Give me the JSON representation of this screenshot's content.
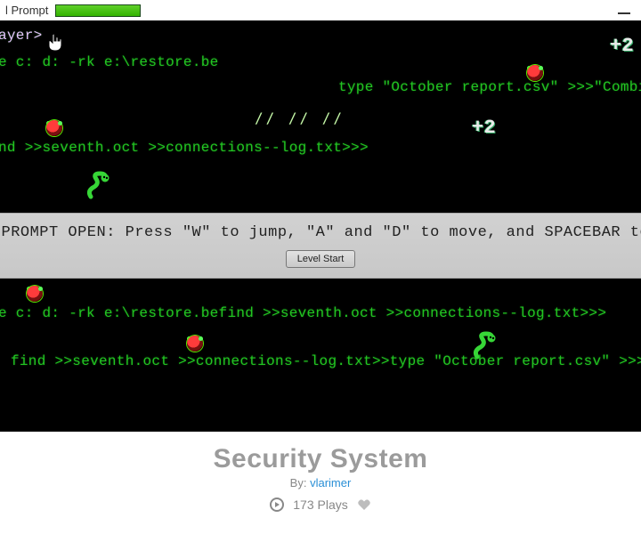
{
  "titlebar": {
    "label_fragment": "l Prompt"
  },
  "scores": {
    "s1": "+2",
    "s2": "+2"
  },
  "lines": {
    "ayer": "ayer>",
    "restore1": "e c: d: -rk e:\\restore.be",
    "typeOct1": "type \"October report.csv\" >>>\"Combined repo",
    "slashes1": "//   //   //",
    "findConn1": "nd >>seventh.oct >>connections--log.txt>>>",
    "restore2_left": "e c: d: -rk e:\\restore.be",
    "restore2_right": "find >>seventh.oct >>connections--log.txt>>>",
    "lastline_left": "find >>seventh.oct >>connections--log.txt>>",
    "lastline_mid": "type \"October report.csv\" ",
    "lastline_right": ">>>\"Combined report.c"
  },
  "banner": {
    "text": "MMAND PROMPT OPEN: Press \"W\" to jump, \"A\" and \"D\" to move, and SPACEBAR to shoo",
    "button": "Level Start"
  },
  "meta": {
    "title": "Security System",
    "by_prefix": "By: ",
    "author": "vlarimer",
    "plays": "173 Plays"
  }
}
